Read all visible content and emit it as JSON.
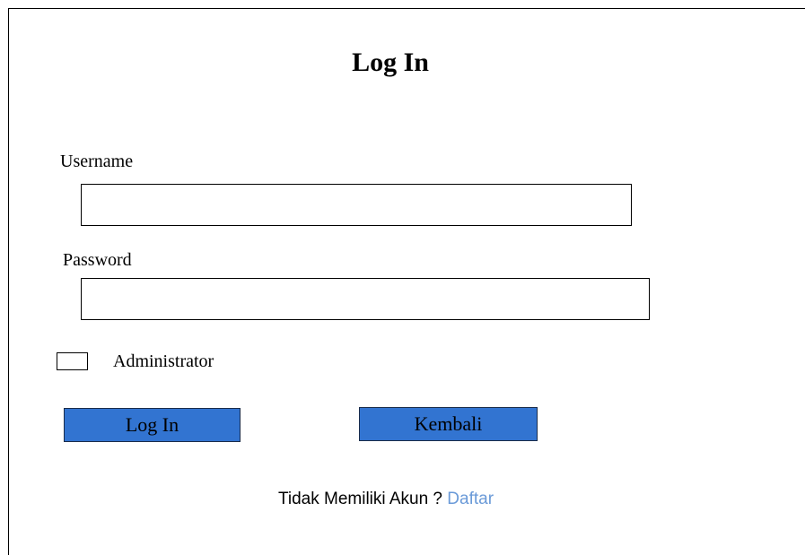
{
  "page": {
    "title": "Log In"
  },
  "form": {
    "username_label": "Username",
    "username_value": "",
    "password_label": "Password",
    "password_value": "",
    "admin_checkbox_label": "Administrator",
    "admin_checked": false
  },
  "buttons": {
    "login_label": "Log In",
    "back_label": "Kembali"
  },
  "footer": {
    "prompt": "Tidak Memiliki Akun ?",
    "register_link": "Daftar"
  },
  "colors": {
    "button_fill": "#3274d1",
    "link": "#6a9ad8"
  },
  "icons": [
    "checkbox-icon"
  ]
}
